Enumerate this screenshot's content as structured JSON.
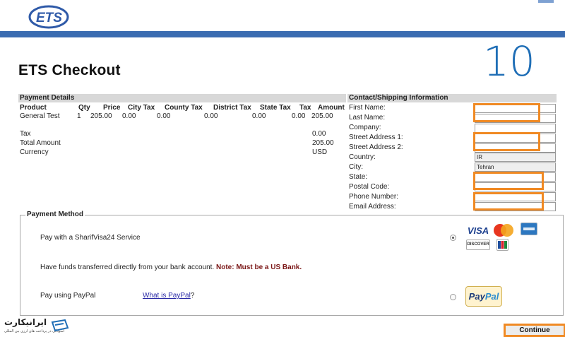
{
  "header": {
    "logo_text": "ETS"
  },
  "page": {
    "title": "ETS Checkout",
    "step_number": "10"
  },
  "payment_details": {
    "heading": "Payment Details",
    "columns": [
      "Product",
      "Qty",
      "Price",
      "City Tax",
      "County Tax",
      "District Tax",
      "State Tax",
      "Tax",
      "Amount"
    ],
    "row": {
      "product": "General Test",
      "qty": "1",
      "price": "205.00",
      "city_tax": "0.00",
      "county_tax": "0.00",
      "district_tax": "0.00",
      "state_tax": "0.00",
      "tax": "0.00",
      "amount": "205.00"
    },
    "totals": {
      "tax_label": "Tax",
      "tax_value": "0.00",
      "total_label": "Total Amount",
      "total_value": "205.00",
      "currency_label": "Currency",
      "currency_value": "USD"
    }
  },
  "contact": {
    "heading": "Contact/Shipping Information",
    "fields": [
      {
        "label": "First Name:",
        "value": ""
      },
      {
        "label": "Last Name:",
        "value": ""
      },
      {
        "label": "Company:",
        "value": ""
      },
      {
        "label": "Street Address 1:",
        "value": ""
      },
      {
        "label": "Street Address 2:",
        "value": ""
      },
      {
        "label": "Country:",
        "value": "IR"
      },
      {
        "label": "City:",
        "value": "Tehran"
      },
      {
        "label": "State:",
        "value": ""
      },
      {
        "label": "Postal Code:",
        "value": ""
      },
      {
        "label": "Phone Number:",
        "value": ""
      },
      {
        "label": "Email Address:",
        "value": ""
      }
    ]
  },
  "payment_method": {
    "heading": "Payment Method",
    "option1": "Pay with a SharifVisa24 Service",
    "option2_text": "Have funds transferred directly from your bank account.",
    "option2_note": "Note: Must be a US Bank.",
    "option3": "Pay using PayPal",
    "paypal_link": "What is PayPal",
    "paypal_link_suffix": "?",
    "cards": {
      "visa": "VISA",
      "discover": "DISCOVER",
      "paypal_a": "Pay",
      "paypal_b": "Pal"
    }
  },
  "actions": {
    "continue": "Continue"
  },
  "watermark": {
    "name": "ایرانیکارت",
    "tagline": "آسودگی در پرداخت های ارزی بین المللی"
  },
  "colors": {
    "brand_blue": "#3b6cb1",
    "highlight": "#f08a24",
    "step_blue": "#1f6eb6"
  }
}
